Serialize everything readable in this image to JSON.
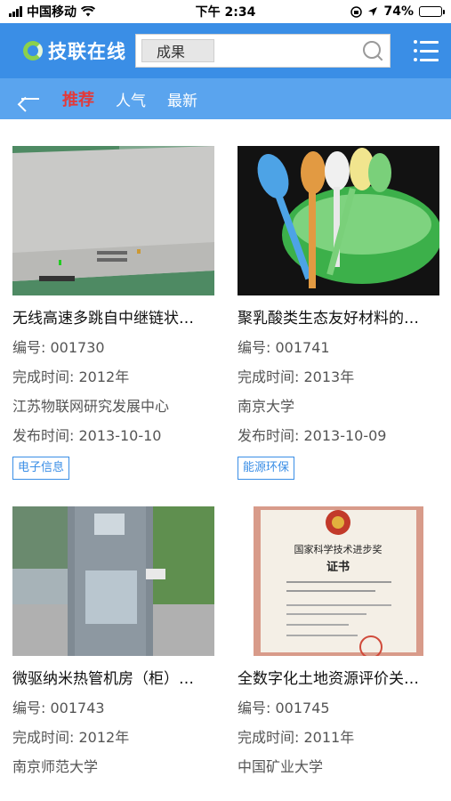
{
  "status": {
    "carrier": "中国移动",
    "time": "下午 2:34",
    "battery": "74%",
    "battery_level": 0.74
  },
  "header": {
    "app_name": "技联在线",
    "search_tag": "成果",
    "search_placeholder": "",
    "icons": [
      "logo-icon",
      "search-icon",
      "menu-icon"
    ]
  },
  "nav": {
    "tabs": [
      {
        "label": "推荐",
        "active": true
      },
      {
        "label": "人气",
        "active": false
      },
      {
        "label": "最新",
        "active": false
      }
    ]
  },
  "items": [
    {
      "title": "无线高速多跳自中继链状…",
      "number": "编号: 001730",
      "completed": "完成时间:   2012年",
      "org": "江苏物联网研究发展中心",
      "published": "发布时间: 2013-10-10",
      "tag": "电子信息"
    },
    {
      "title": "聚乳酸类生态友好材料的…",
      "number": "编号: 001741",
      "completed": "完成时间:   2013年",
      "org": "南京大学",
      "published": "发布时间: 2013-10-09",
      "tag": "能源环保"
    },
    {
      "title": "微驱纳米热管机房（柜）…",
      "number": "编号: 001743",
      "completed": "完成时间:   2012年",
      "org": "南京师范大学",
      "published": "",
      "tag": ""
    },
    {
      "title": "全数字化土地资源评价关…",
      "number": "编号: 001745",
      "completed": "完成时间:   2011年",
      "org": "中国矿业大学",
      "published": "",
      "tag": ""
    }
  ],
  "certificate": {
    "heading": "国家科学技术进步奖",
    "subheading": "证书"
  },
  "colors": {
    "header_bg": "#3a8ee6",
    "subnav_bg": "#5aa4ee",
    "active_tab": "#e23a3a",
    "tag_border": "#3a8ee6"
  }
}
